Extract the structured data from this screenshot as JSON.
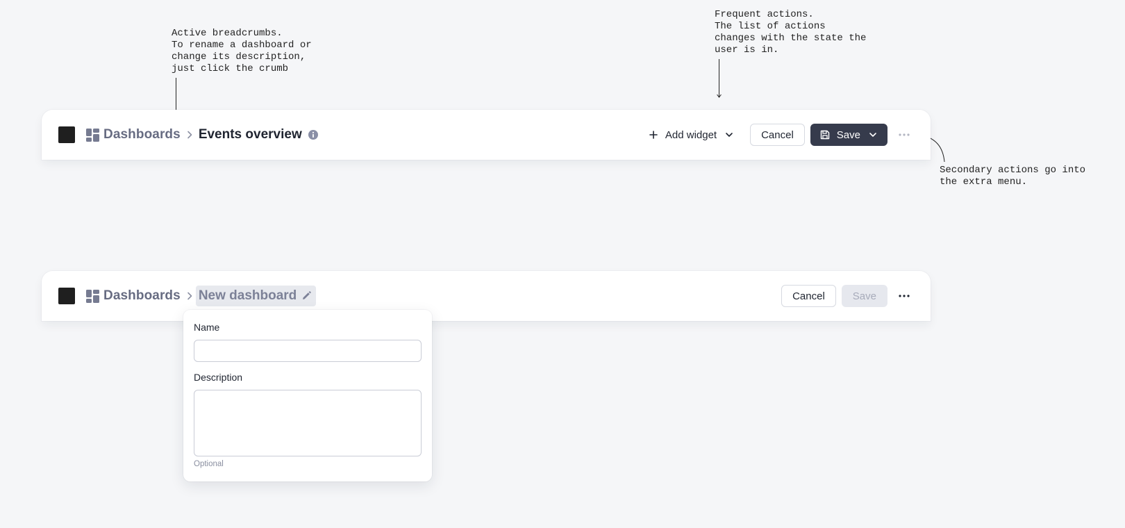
{
  "annotations": {
    "breadcrumbs_note": "Active breadcrumbs.\nTo rename a dashboard or\nchange its description,\njust click the crumb",
    "frequent_actions_note": "Frequent actions.\nThe list of actions\nchanges with the state the\nuser is in.",
    "secondary_actions_note": "Secondary actions go into\nthe extra menu."
  },
  "header_view": {
    "breadcrumb_root": "Dashboards",
    "breadcrumb_current": "Events overview",
    "add_widget_label": "Add widget",
    "cancel_label": "Cancel",
    "save_label": "Save"
  },
  "header_edit": {
    "breadcrumb_root": "Dashboards",
    "breadcrumb_current": "New dashboard",
    "cancel_label": "Cancel",
    "save_label": "Save"
  },
  "rename_popover": {
    "name_label": "Name",
    "name_value": "",
    "description_label": "Description",
    "description_value": "",
    "hint": "Optional"
  },
  "icons": {
    "breadcrumb": "dashboard-grid-icon",
    "separator": "chevron-right-icon",
    "info": "info-icon",
    "add": "plus-icon",
    "dropdown": "chevron-down-icon",
    "save": "floppy-disk-icon",
    "more": "ellipsis-icon",
    "edit": "pencil-icon"
  },
  "colors": {
    "background": "#f5f6f8",
    "primary_button": "#363b4c",
    "muted_text": "#676c82",
    "disabled_button": "#e6e8ee"
  }
}
